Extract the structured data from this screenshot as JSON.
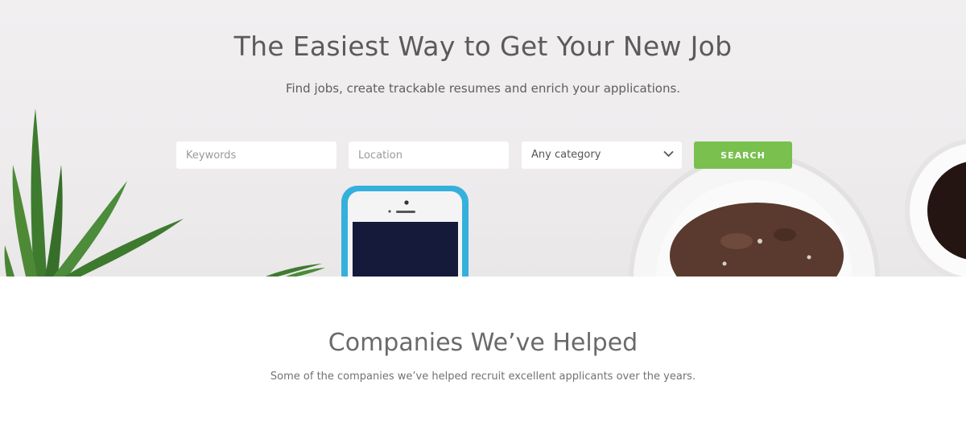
{
  "hero": {
    "title": "The Easiest Way to Get Your New Job",
    "subtitle": "Find jobs, create trackable resumes and enrich your applications."
  },
  "search": {
    "keywords_placeholder": "Keywords",
    "location_placeholder": "Location",
    "category_value": "Any category",
    "button_label": "SEARCH"
  },
  "companies": {
    "title": "Companies We’ve Helped",
    "subtitle": "Some of the companies we’ve helped recruit excellent applicants over the years."
  },
  "colors": {
    "accent": "#79c04f",
    "phone_case": "#35b0dc",
    "cookie": "#5a3a2e",
    "plant": "#3f7a30"
  },
  "icons": [
    "chevron-down-icon",
    "plant-image",
    "phone-image",
    "cookie-plate-image",
    "coffee-cup-image"
  ]
}
